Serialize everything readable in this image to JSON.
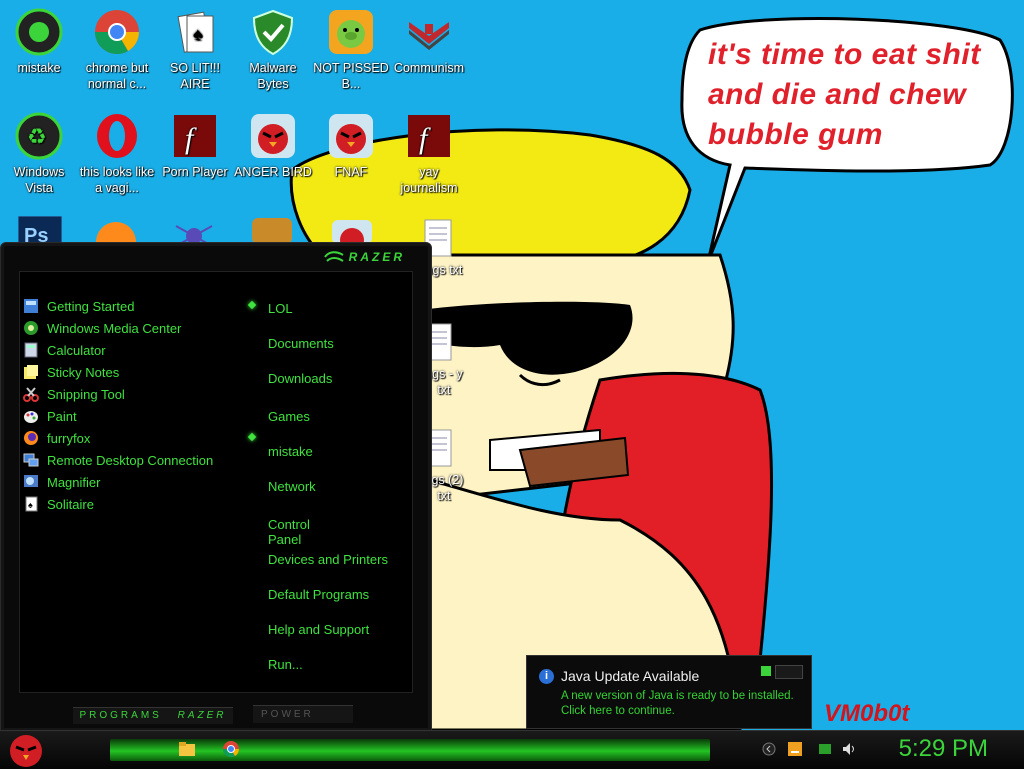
{
  "wallpaper": {
    "speech_lines": [
      "it's time to eat shit",
      "and die and chew",
      "bubble gum"
    ],
    "signature": "VM0b0t"
  },
  "desktop_icons": [
    {
      "label": "mistake",
      "icon": "razer-green-icon"
    },
    {
      "label": "chrome but normal c...",
      "icon": "chrome-icon"
    },
    {
      "label": "SO LIT!!! AIRE",
      "icon": "solitaire-icon"
    },
    {
      "label": "Malware Bytes",
      "icon": "shield-icon"
    },
    {
      "label": "NOT PISSED B...",
      "icon": "bad-piggies-icon"
    },
    {
      "label": "Communism",
      "icon": "emblem-icon"
    },
    {
      "label": "Windows Vista",
      "icon": "recycle-icon"
    },
    {
      "label": "this looks like a vagi...",
      "icon": "opera-icon"
    },
    {
      "label": "Porn Player",
      "icon": "flash-icon"
    },
    {
      "label": "ANGER BIRD",
      "icon": "angry-bird-icon"
    },
    {
      "label": "FNAF",
      "icon": "angry-bird-icon"
    },
    {
      "label": "yay journalism",
      "icon": "flash-icon"
    },
    {
      "label": "ngs txt",
      "icon": "text-file-icon"
    },
    {
      "label": "ngs - y txt",
      "icon": "text-file-icon"
    },
    {
      "label": "ngs (2) txt",
      "icon": "text-file-icon"
    }
  ],
  "start_menu": {
    "brand": "RAZER",
    "left_items": [
      {
        "label": "Getting Started",
        "icon": "getting-started-icon",
        "has_arrow": true
      },
      {
        "label": "Windows Media Center",
        "icon": "media-center-icon",
        "has_arrow": false
      },
      {
        "label": "Calculator",
        "icon": "calculator-icon",
        "has_arrow": false
      },
      {
        "label": "Sticky Notes",
        "icon": "sticky-notes-icon",
        "has_arrow": false
      },
      {
        "label": "Snipping Tool",
        "icon": "scissors-icon",
        "has_arrow": false
      },
      {
        "label": "Paint",
        "icon": "paint-icon",
        "has_arrow": false
      },
      {
        "label": "furryfox",
        "icon": "firefox-icon",
        "has_arrow": true
      },
      {
        "label": "Remote Desktop Connection",
        "icon": "remote-desktop-icon",
        "has_arrow": false
      },
      {
        "label": "Magnifier",
        "icon": "magnifier-icon",
        "has_arrow": false
      },
      {
        "label": "Solitaire",
        "icon": "solitaire-icon",
        "has_arrow": false
      }
    ],
    "right_items": [
      "LOL",
      "Documents",
      "Downloads",
      "Games",
      "mistake",
      "Network",
      "Control Panel",
      "Devices and Printers",
      "Default Programs",
      "Help and Support",
      "Run..."
    ],
    "programs_label": "PROGRAMS",
    "programs_brand": "RAZER",
    "power_label": "POWER"
  },
  "notification": {
    "title": "Java Update Available",
    "body": "A new version of Java is ready to be installed. Click here to continue."
  },
  "taskbar": {
    "clock": "5:29 PM"
  },
  "colors": {
    "accent_green": "#3fe23f",
    "desktop_blue": "#1aaee8"
  }
}
